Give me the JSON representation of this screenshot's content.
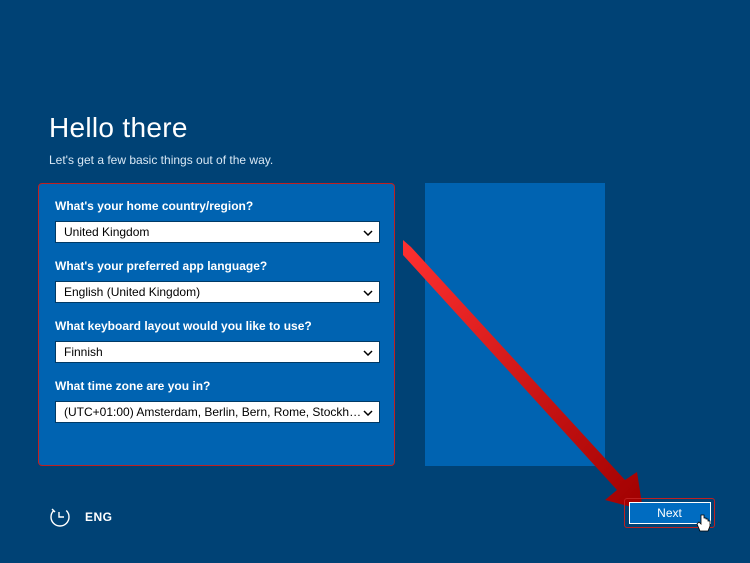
{
  "header": {
    "title": "Hello there",
    "subtitle": "Let's get a few basic things out of the way."
  },
  "form": {
    "country_label": "What's your home country/region?",
    "country_value": "United Kingdom",
    "language_label": "What's your preferred app language?",
    "language_value": "English (United Kingdom)",
    "keyboard_label": "What keyboard layout would you like to use?",
    "keyboard_value": "Finnish",
    "timezone_label": "What time zone are you in?",
    "timezone_value": "(UTC+01:00) Amsterdam, Berlin, Bern, Rome, Stockholm,..."
  },
  "footer": {
    "lang_indicator": "ENG",
    "next_label": "Next"
  },
  "colors": {
    "bg": "#004275",
    "panel": "#0063b1",
    "highlight": "#c02020",
    "button": "#006cc1"
  }
}
